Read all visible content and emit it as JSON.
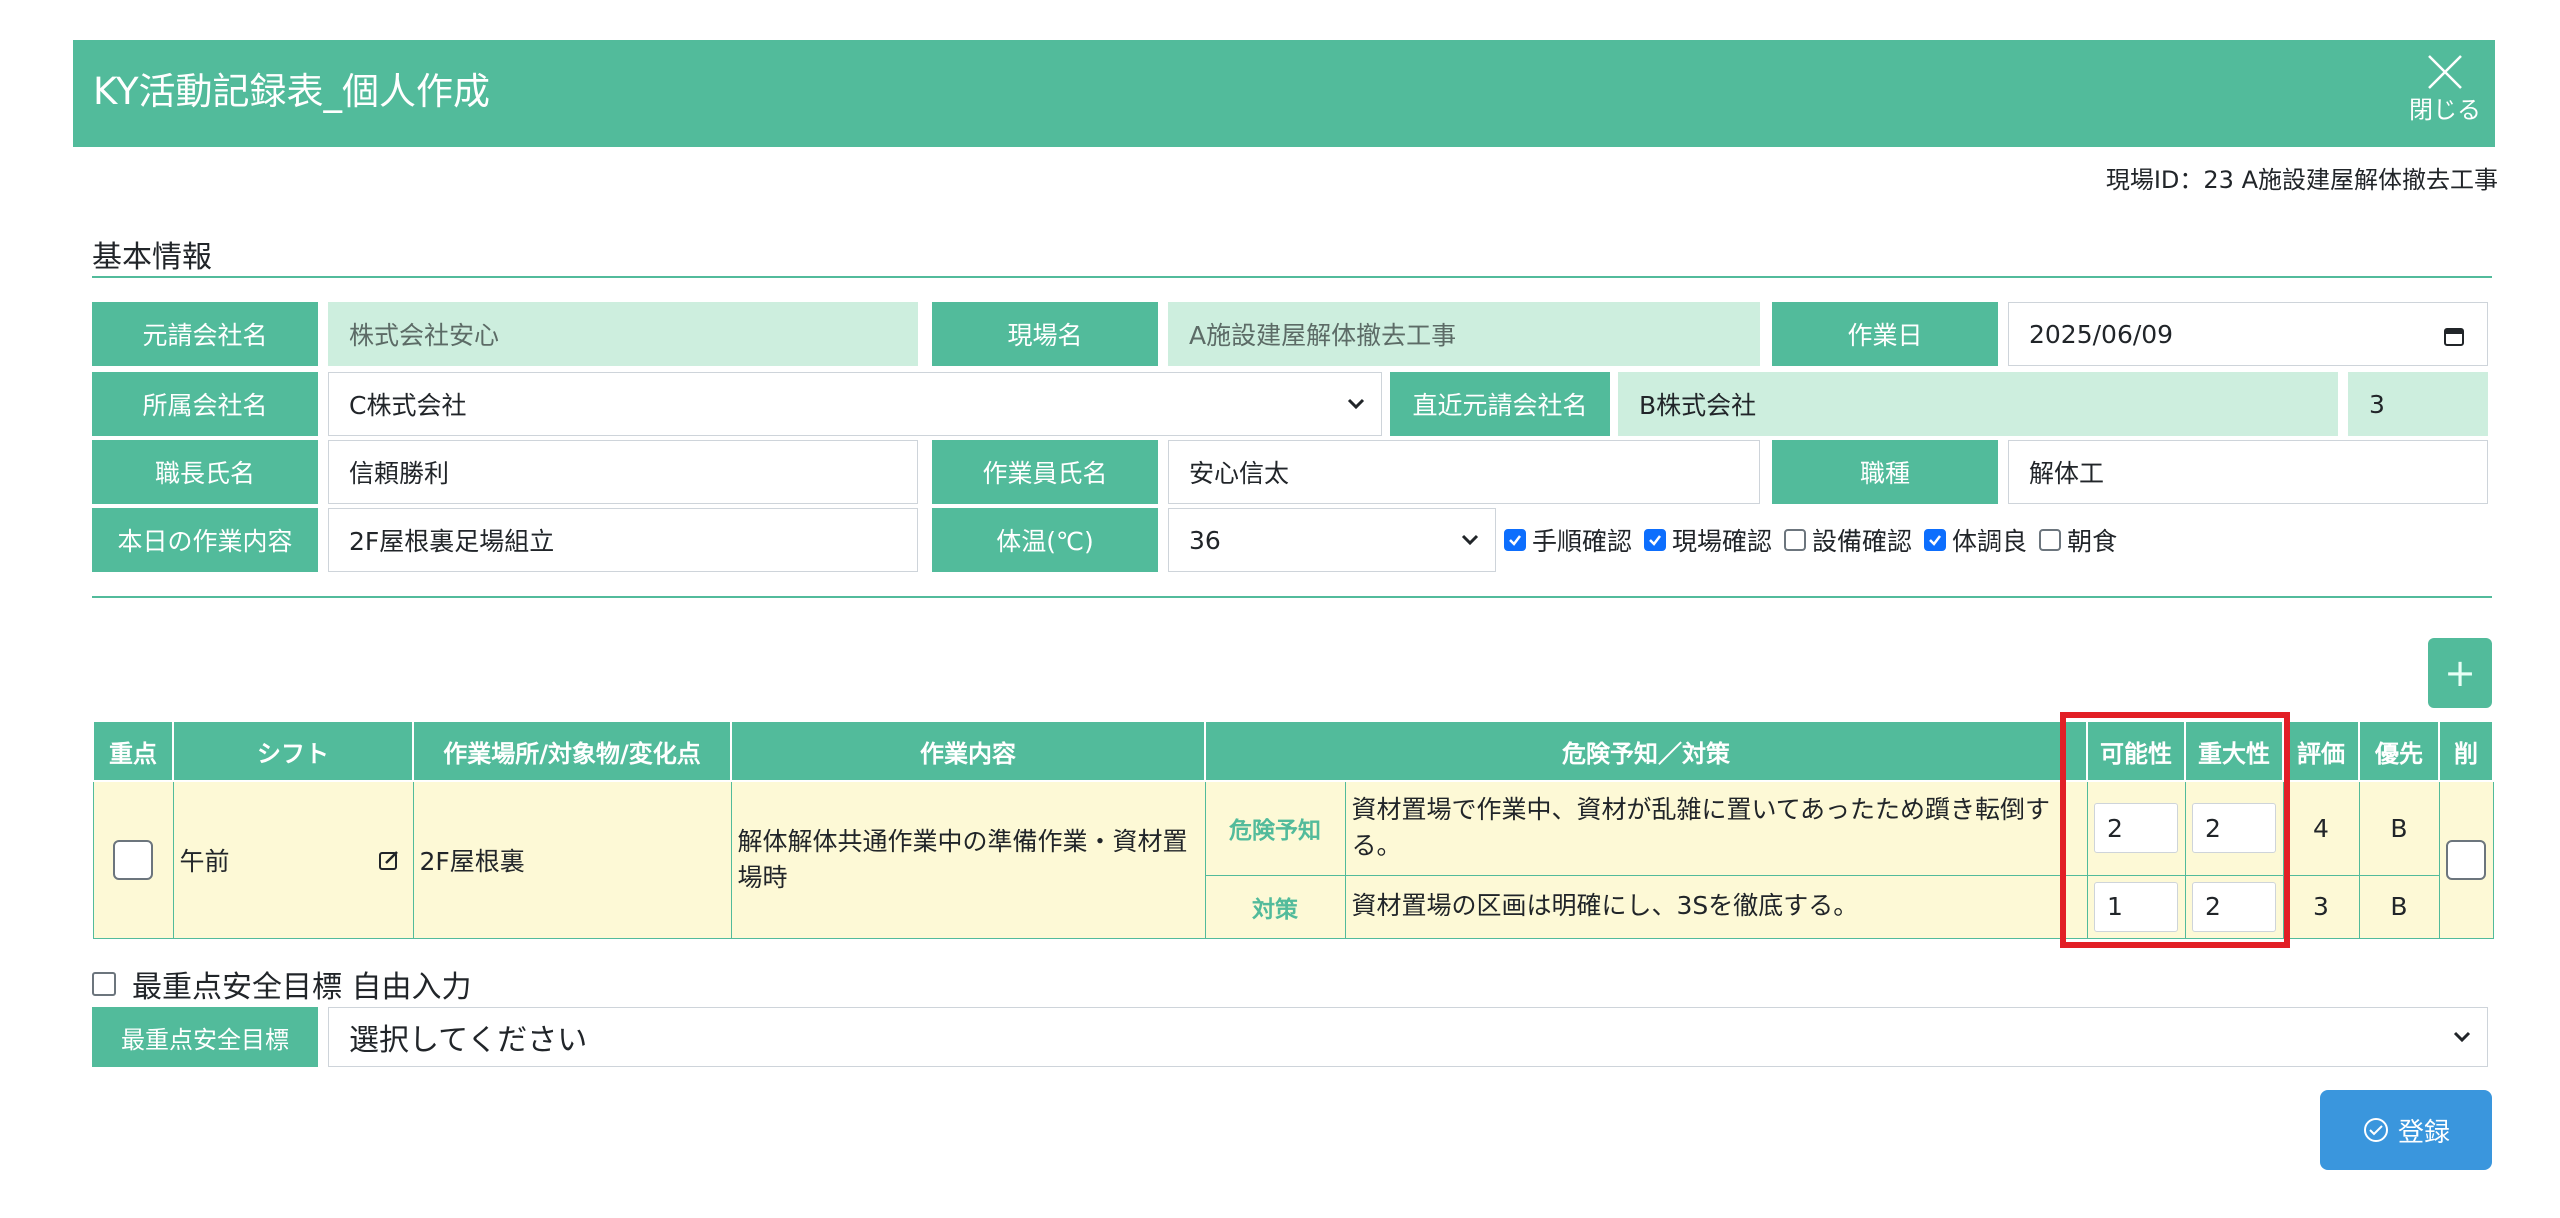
{
  "header": {
    "title": "KY活動記録表_個人作成",
    "close_label": "閉じる"
  },
  "site_id": "現場ID：23 A施設建屋解体撤去工事",
  "section_title": "基本情報",
  "basic": {
    "prime_company_label": "元請会社名",
    "prime_company_value": "株式会社安心",
    "site_name_label": "現場名",
    "site_name_value": "A施設建屋解体撤去工事",
    "work_date_label": "作業日",
    "work_date_value": "2025/06/09",
    "affiliation_label": "所属会社名",
    "affiliation_value": "C株式会社",
    "direct_prime_label": "直近元請会社名",
    "direct_prime_value": "B株式会社",
    "direct_prime_number": "3",
    "foreman_label": "職長氏名",
    "foreman_value": "信頼勝利",
    "worker_label": "作業員氏名",
    "worker_value": "安心信太",
    "job_type_label": "職種",
    "job_type_value": "解体工",
    "today_work_label": "本日の作業内容",
    "today_work_value": "2F屋根裏足場組立",
    "temp_label": "体温(℃)",
    "temp_value": "36"
  },
  "checks": [
    {
      "label": "手順確認",
      "checked": true
    },
    {
      "label": "現場確認",
      "checked": true
    },
    {
      "label": "設備確認",
      "checked": false
    },
    {
      "label": "体調良",
      "checked": true
    },
    {
      "label": "朝食",
      "checked": false
    }
  ],
  "add_button": "+",
  "table": {
    "headers": {
      "focus": "重点",
      "shift": "シフト",
      "place": "作業場所/対象物/変化点",
      "work": "作業内容",
      "hazard": "危険予知／対策",
      "likelihood": "可能性",
      "severity": "重大性",
      "score": "評価",
      "priority": "優先",
      "delete": "削"
    },
    "row": {
      "shift": "午前",
      "place": "2F屋根裏",
      "work": "解体解体共通作業中の準備作業・資材置場時",
      "hazard_label": "危険予知",
      "hazard_text": "資材置場で作業中、資材が乱雑に置いてあったため躓き転倒する。",
      "hazard_likelihood": "2",
      "hazard_severity": "2",
      "hazard_score": "4",
      "hazard_priority": "B",
      "measure_label": "対策",
      "measure_text": "資材置場の区画は明確にし、3Sを徹底する。",
      "measure_likelihood": "1",
      "measure_severity": "2",
      "measure_score": "3",
      "measure_priority": "B"
    }
  },
  "free_input_label": "最重点安全目標 自由入力",
  "goal": {
    "label": "最重点安全目標",
    "value": "選択してください"
  },
  "register_label": "登録",
  "colors": {
    "primary": "#52bb9b",
    "readonly": "#cdeede",
    "row_bg": "#fdf9d6",
    "highlight": "#e21f26",
    "register": "#3a96dd"
  }
}
